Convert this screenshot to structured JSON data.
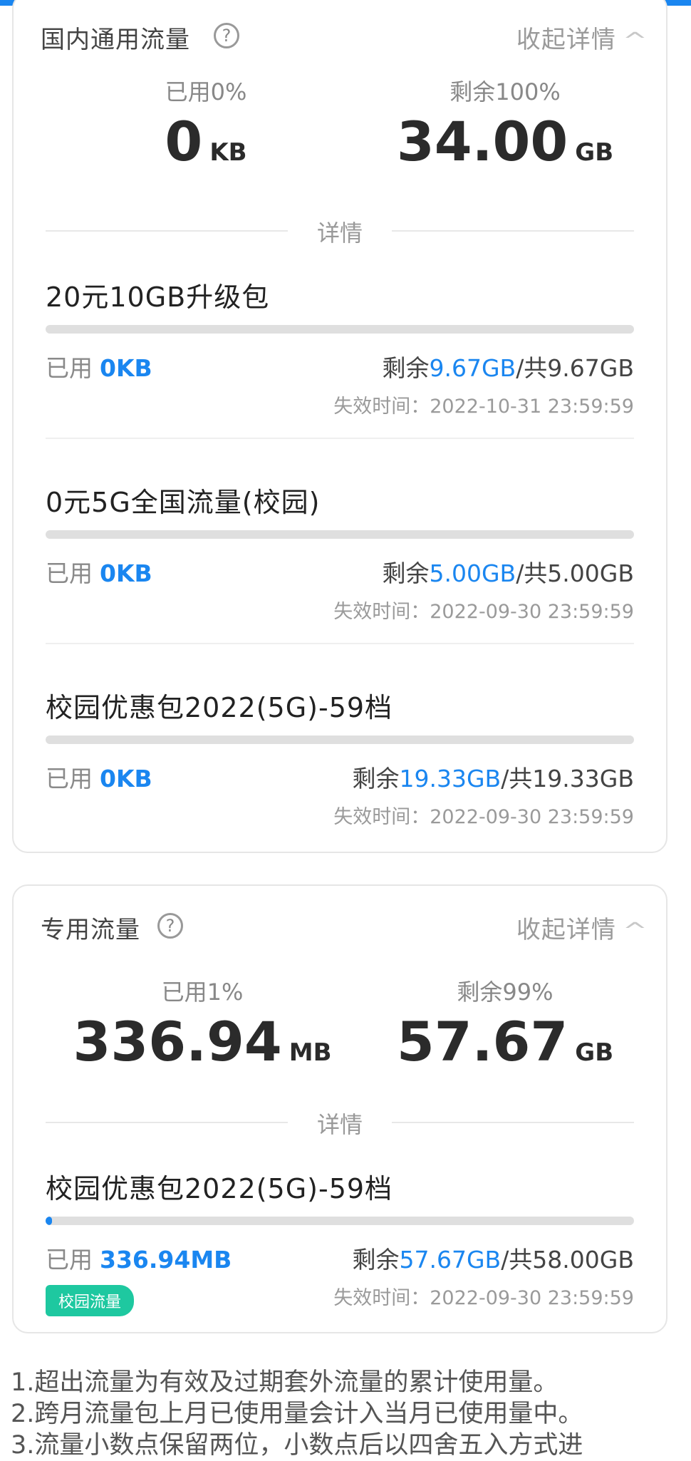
{
  "domestic": {
    "title": "国内通用流量",
    "collapse_label": "收起详情",
    "used_label": "已用0%",
    "used_value": "0",
    "used_unit": "KB",
    "remain_label": "剩余100%",
    "remain_value": "34.00",
    "remain_unit": "GB",
    "detail_label": "详情",
    "packages": [
      {
        "name": "20元10GB升级包",
        "used_label": "已用",
        "used_value": "0KB",
        "remain_prefix": "剩余",
        "remain_value": "9.67GB",
        "total_text": "/共9.67GB",
        "expire": "失效时间：2022-10-31 23:59:59",
        "progress": 0
      },
      {
        "name": "0元5G全国流量(校园)",
        "used_label": "已用",
        "used_value": "0KB",
        "remain_prefix": "剩余",
        "remain_value": "5.00GB",
        "total_text": "/共5.00GB",
        "expire": "失效时间：2022-09-30 23:59:59",
        "progress": 0
      },
      {
        "name": "校园优惠包2022(5G)-59档",
        "used_label": "已用",
        "used_value": "0KB",
        "remain_prefix": "剩余",
        "remain_value": "19.33GB",
        "total_text": "/共19.33GB",
        "expire": "失效时间：2022-09-30 23:59:59",
        "progress": 0
      }
    ]
  },
  "dedicated": {
    "title": "专用流量",
    "collapse_label": "收起详情",
    "used_label": "已用1%",
    "used_value": "336.94",
    "used_unit": "MB",
    "remain_label": "剩余99%",
    "remain_value": "57.67",
    "remain_unit": "GB",
    "detail_label": "详情",
    "packages": [
      {
        "name": "校园优惠包2022(5G)-59档",
        "used_label": "已用",
        "used_value": "336.94MB",
        "remain_prefix": "剩余",
        "remain_value": "57.67GB",
        "total_text": "/共58.00GB",
        "expire": "失效时间：2022-09-30 23:59:59",
        "tag": "校园流量",
        "progress": 0.01
      }
    ]
  },
  "notes": [
    "1.超出流量为有效及过期套外流量的累计使用量。",
    "2.跨月流量包上月已使用量会计入当月已使用量中。",
    "3.流量小数点保留两位，小数点后以四舍五入方式进"
  ],
  "colors": {
    "accent": "#1a86f0",
    "tag": "#1ec8a0"
  },
  "icons": {
    "help": "help-icon",
    "collapse": "chevron-up-icon"
  }
}
